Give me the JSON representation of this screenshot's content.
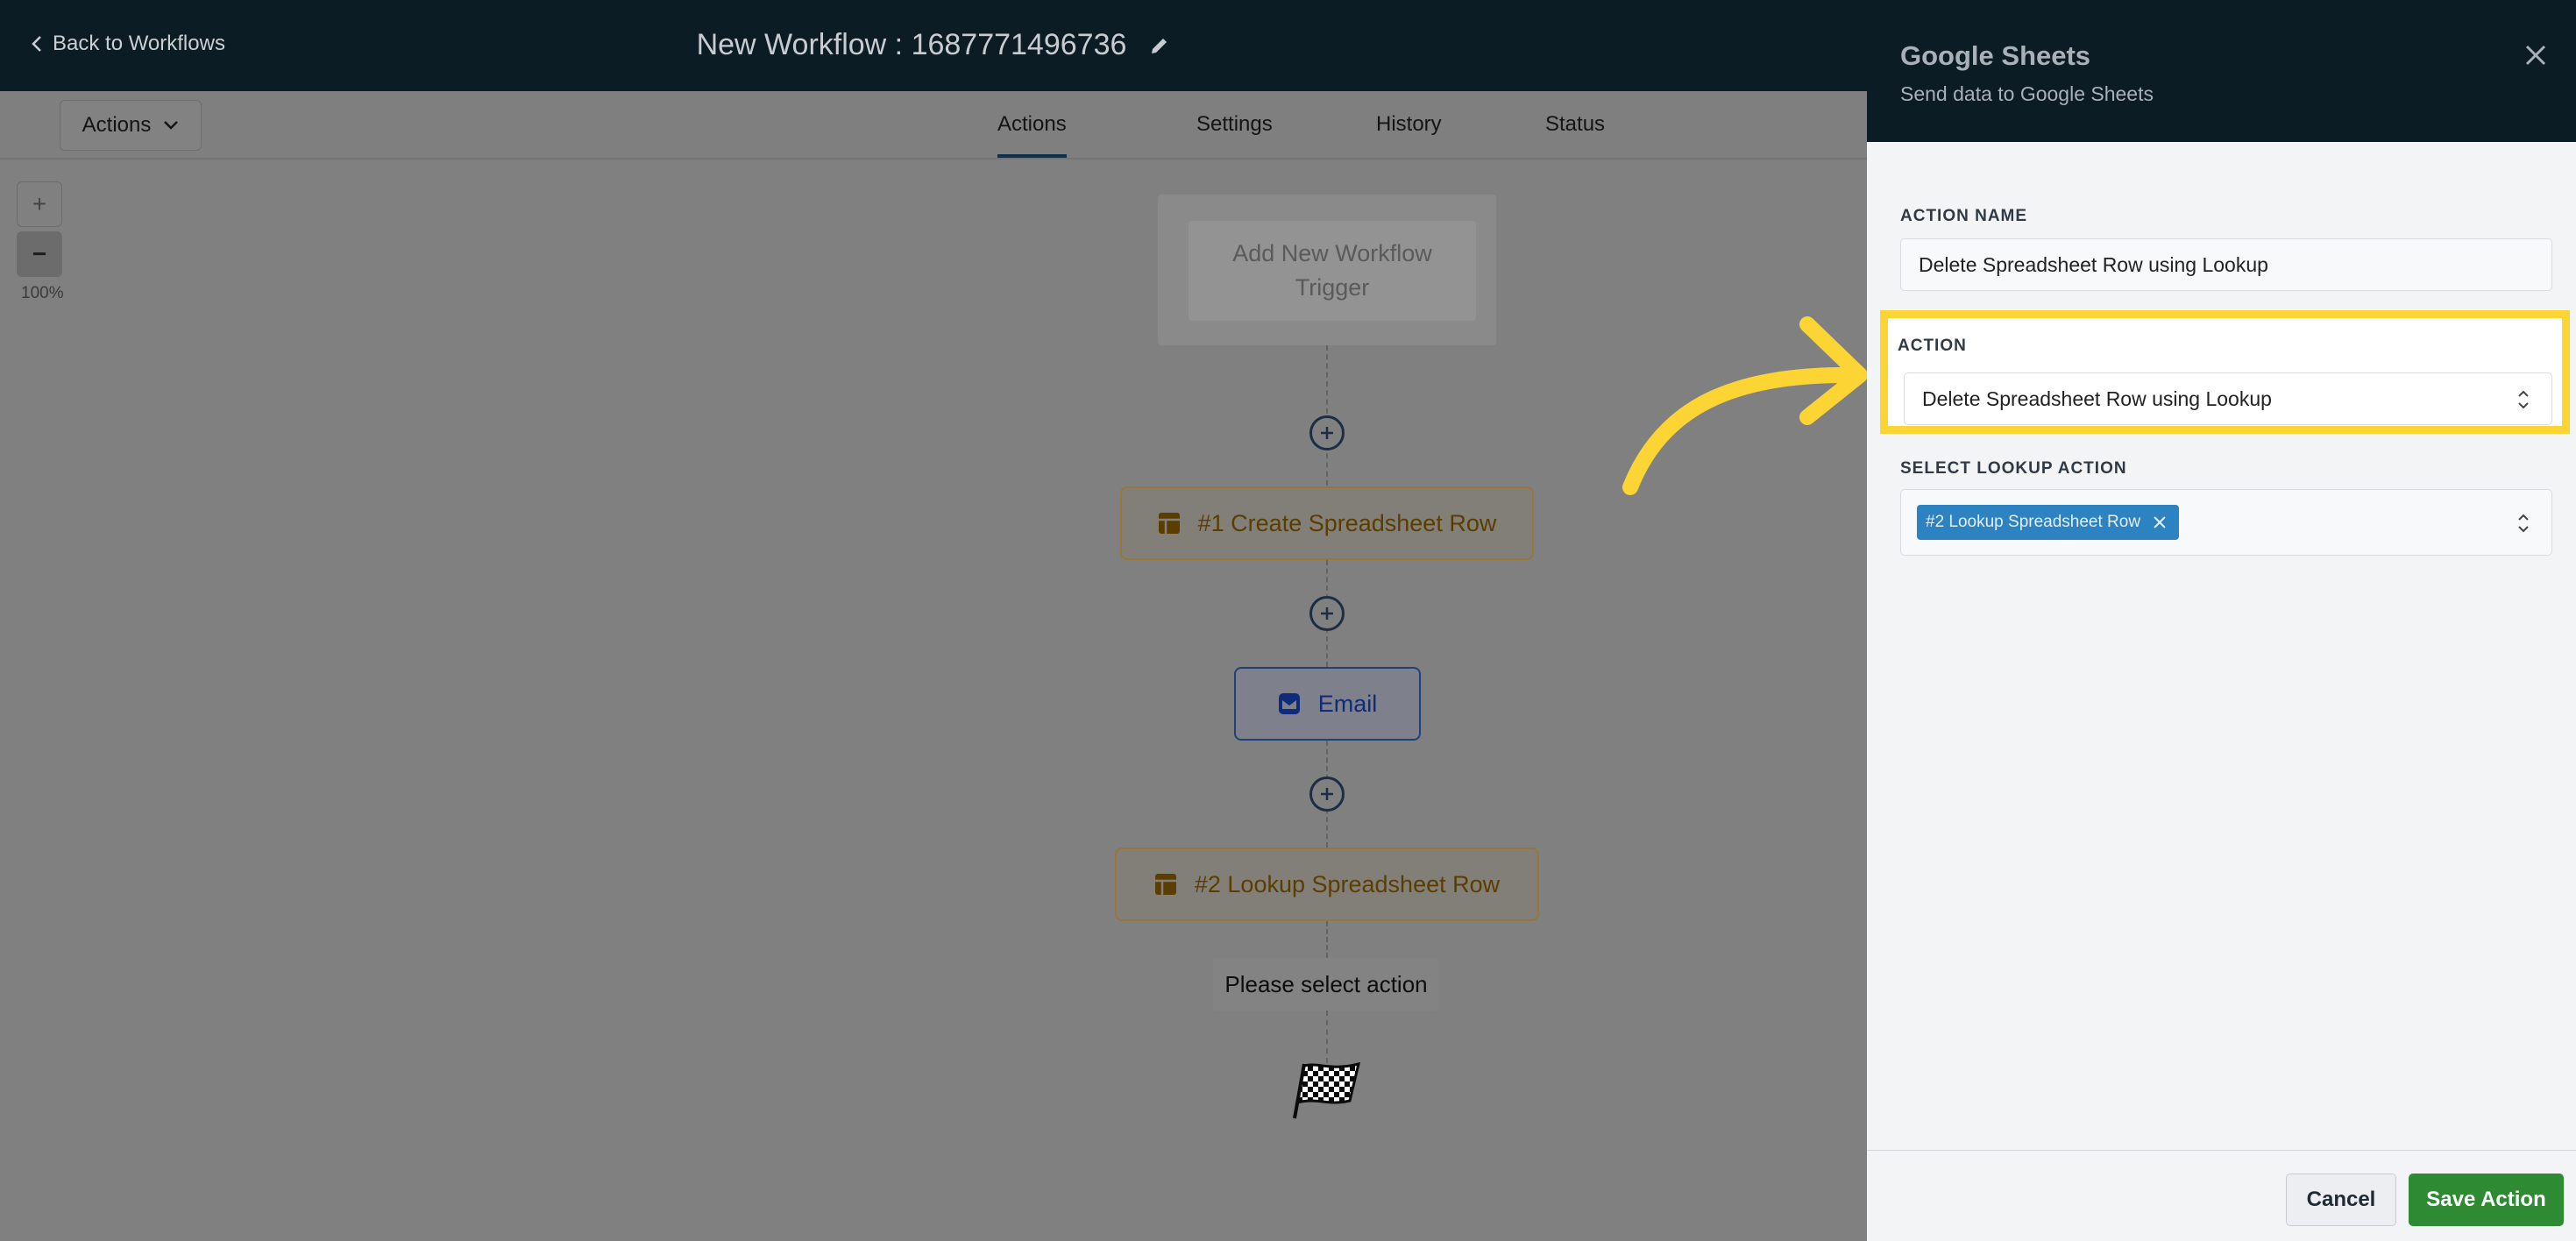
{
  "header": {
    "back_label": "Back to Workflows",
    "workflow_title": "New Workflow : 1687771496736"
  },
  "subbar": {
    "actions_dropdown": "Actions",
    "tabs": [
      {
        "label": "Actions",
        "active": true
      },
      {
        "label": "Settings",
        "active": false
      },
      {
        "label": "History",
        "active": false
      },
      {
        "label": "Status",
        "active": false
      }
    ]
  },
  "zoom": {
    "plus": "+",
    "minus": "−",
    "level": "100%"
  },
  "canvas": {
    "trigger_line1": "Add New Workflow",
    "trigger_line2": "Trigger",
    "steps": [
      {
        "label": "#1 Create Spreadsheet Row",
        "icon": "spreadsheet-icon"
      },
      {
        "label": "Email",
        "icon": "email-icon"
      },
      {
        "label": "#2 Lookup Spreadsheet Row",
        "icon": "spreadsheet-icon"
      }
    ],
    "pending_action": "Please select action"
  },
  "panel": {
    "title": "Google Sheets",
    "subtitle": "Send data to Google Sheets",
    "action_name_label": "ACTION NAME",
    "action_name_value": "Delete Spreadsheet Row using Lookup",
    "action_label": "ACTION",
    "action_value": "Delete Spreadsheet Row using Lookup",
    "lookup_label": "SELECT LOOKUP ACTION",
    "lookup_tag": "#2 Lookup Spreadsheet Row",
    "cancel_label": "Cancel",
    "save_label": "Save Action"
  },
  "colors": {
    "highlight": "#fcd535",
    "save_button": "#2e8b34",
    "tag": "#2d82c1",
    "header": "#0c1c25"
  }
}
